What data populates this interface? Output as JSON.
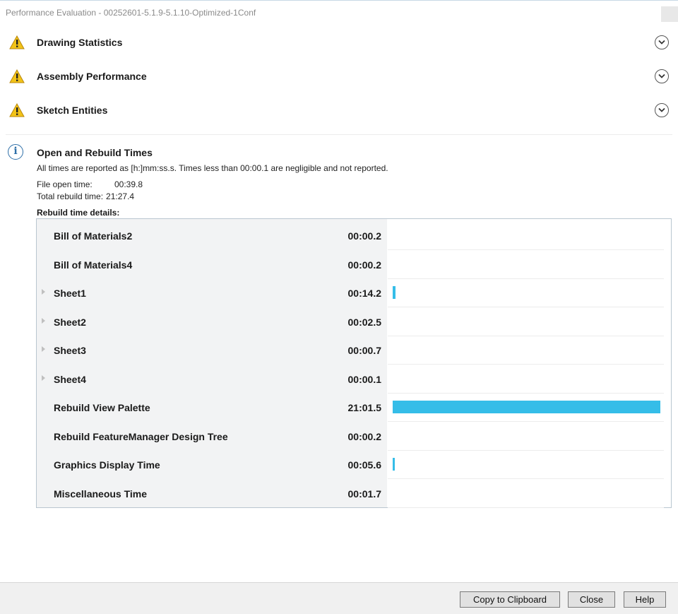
{
  "window": {
    "title": "Performance Evaluation - 00252601-5.1.9-5.1.10-Optimized-1Conf"
  },
  "sections": [
    {
      "label": "Drawing Statistics",
      "icon": "warning-icon"
    },
    {
      "label": "Assembly Performance",
      "icon": "warning-icon"
    },
    {
      "label": "Sketch Entities",
      "icon": "warning-icon"
    }
  ],
  "open_rebuild": {
    "title": "Open and Rebuild Times",
    "description": "All times are reported as [h:]mm:ss.s. Times less than 00:00.1 are negligible and not reported.",
    "file_open_label": "File open time:",
    "file_open_value": "00:39.8",
    "total_rebuild_label": "Total rebuild time:",
    "total_rebuild_value": "21:27.4",
    "details_header": "Rebuild time details:"
  },
  "rebuild_rows": [
    {
      "name": "Bill of Materials2",
      "time": "00:00.2",
      "expandable": false,
      "fraction": 0
    },
    {
      "name": "Bill of Materials4",
      "time": "00:00.2",
      "expandable": false,
      "fraction": 0
    },
    {
      "name": "Sheet1",
      "time": "00:14.2",
      "expandable": true,
      "fraction": 0.011
    },
    {
      "name": "Sheet2",
      "time": "00:02.5",
      "expandable": true,
      "fraction": 0
    },
    {
      "name": "Sheet3",
      "time": "00:00.7",
      "expandable": true,
      "fraction": 0
    },
    {
      "name": "Sheet4",
      "time": "00:00.1",
      "expandable": true,
      "fraction": 0
    },
    {
      "name": "Rebuild View Palette",
      "time": "21:01.5",
      "expandable": false,
      "fraction": 1.0
    },
    {
      "name": "Rebuild FeatureManager Design Tree",
      "time": "00:00.2",
      "expandable": false,
      "fraction": 0
    },
    {
      "name": "Graphics Display Time",
      "time": "00:05.6",
      "expandable": false,
      "fraction": 0.005
    },
    {
      "name": "Miscellaneous Time",
      "time": "00:01.7",
      "expandable": false,
      "fraction": 0
    }
  ],
  "footer": {
    "copy_label": "Copy to Clipboard",
    "close_label": "Close",
    "help_label": "Help"
  },
  "colors": {
    "bar": "#35bde8",
    "warning": "#f2c318",
    "info": "#2e6fa8"
  }
}
